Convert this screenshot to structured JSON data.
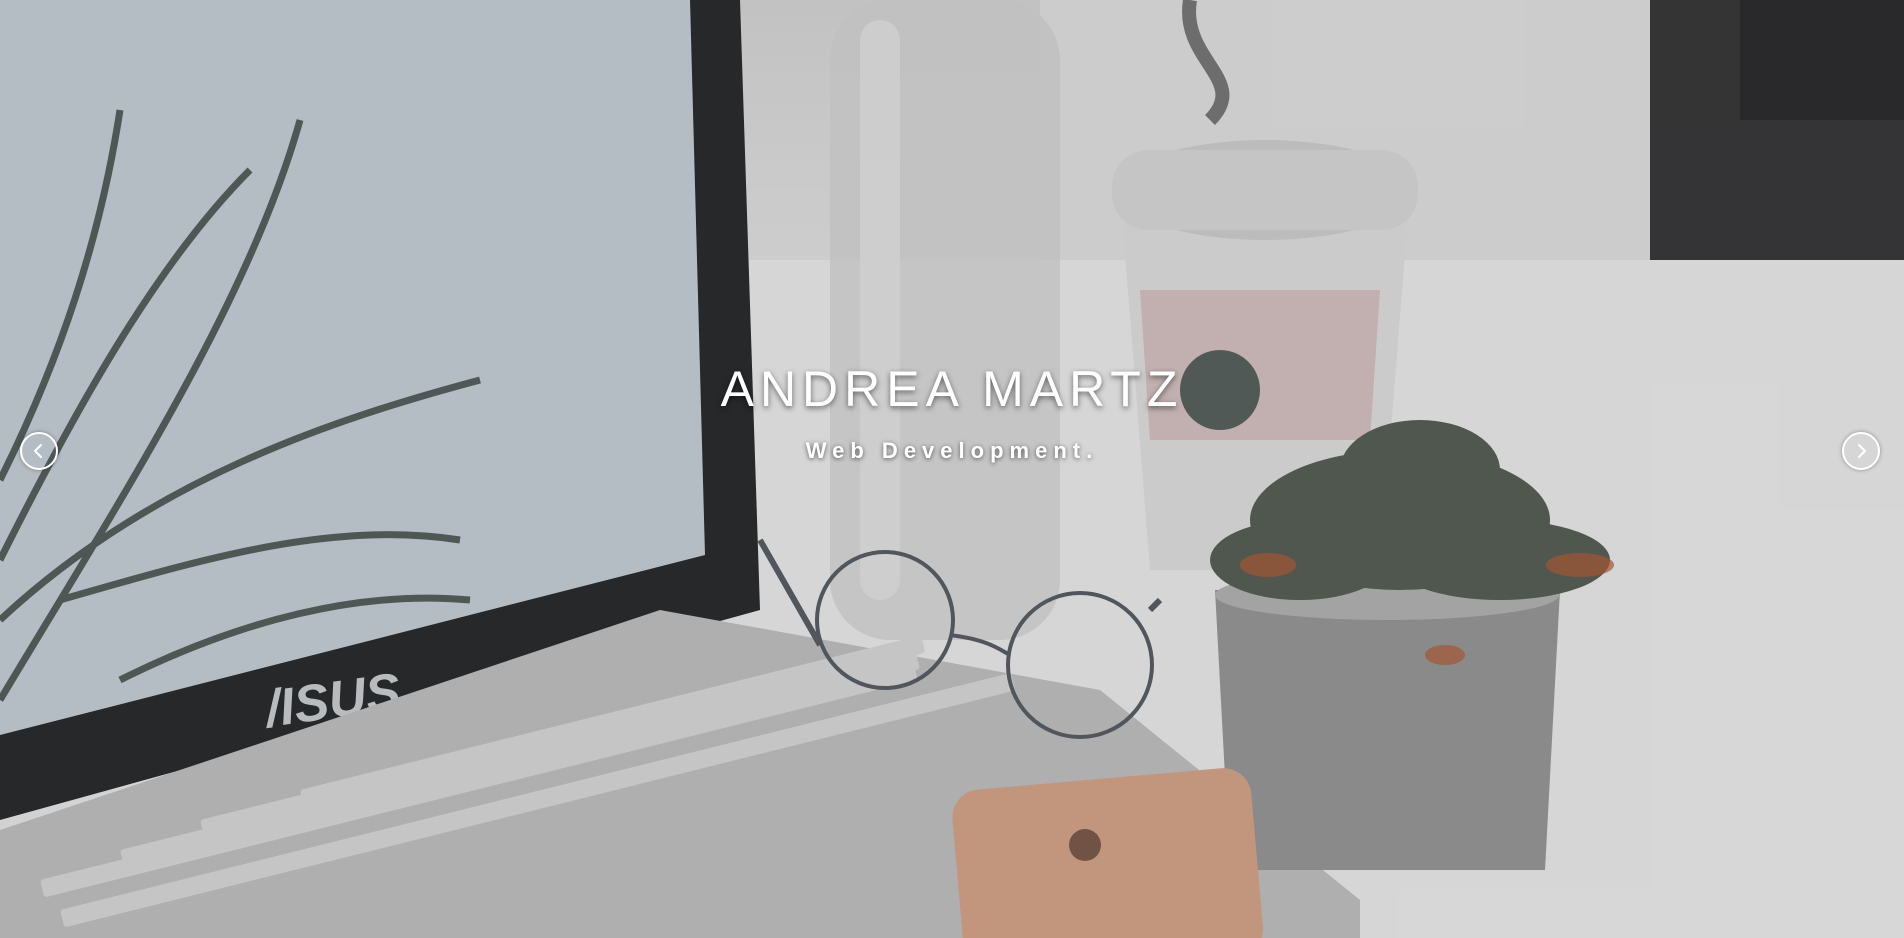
{
  "hero": {
    "name": "ANDREA MARTZ",
    "tagline": "Web Development."
  },
  "carousel": {
    "prev_icon": "chevron-left-icon",
    "next_icon": "chevron-right-icon"
  },
  "background": {
    "laptop_brand": "/ISUS",
    "colors": {
      "backdrop": "#e8e8e8",
      "screen": "#c9d3db",
      "bezel": "#2b2d2f",
      "caption": "#ffffff"
    }
  }
}
